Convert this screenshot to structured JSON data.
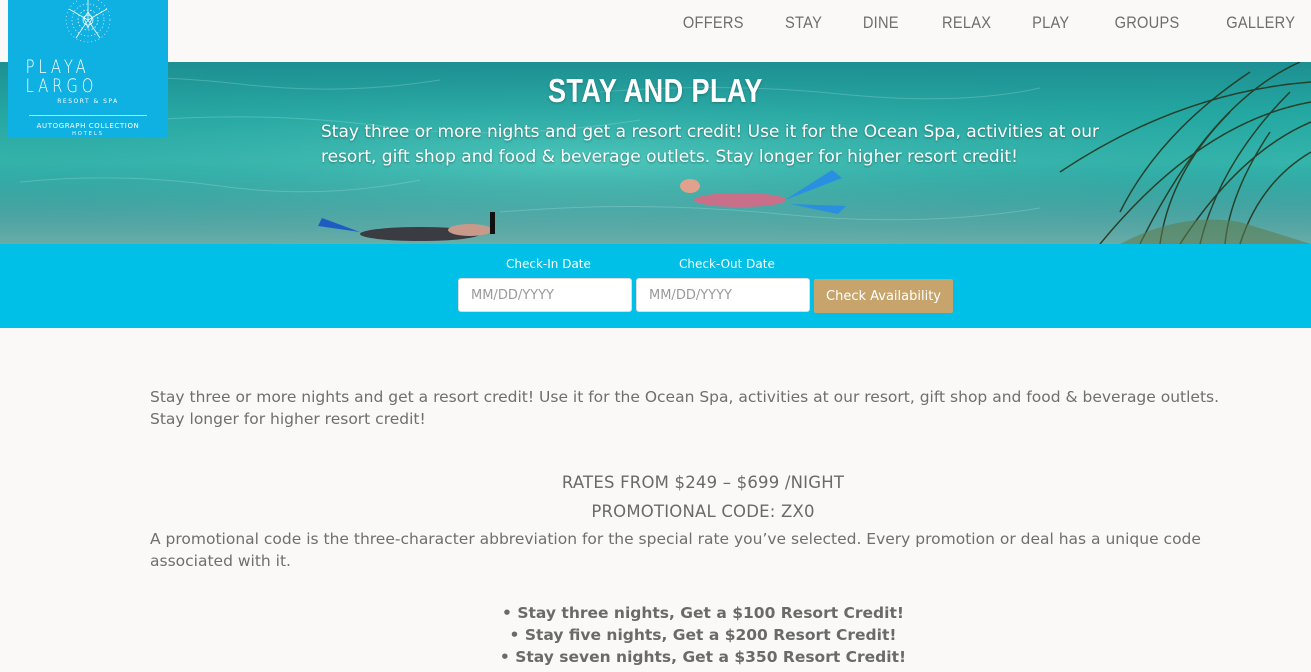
{
  "brand": {
    "name": "PLAYA LARGO",
    "subtitle": "RESORT & SPA",
    "collection": "AUTOGRAPH COLLECTION",
    "collection_sub": "HOTELS",
    "color": "#0fb0e2"
  },
  "nav": {
    "items": [
      "OFFERS",
      "STAY",
      "DINE",
      "RELAX",
      "PLAY",
      "GROUPS",
      "GALLERY"
    ]
  },
  "hero": {
    "title": "STAY AND PLAY",
    "description": "Stay three or more nights and get a resort credit! Use it for the Ocean Spa, activities at our resort, gift shop and food & beverage outlets. Stay longer for higher resort credit!"
  },
  "booking": {
    "checkin_label": "Check-In Date",
    "checkin_placeholder": "MM/DD/YYYY",
    "checkout_label": "Check-Out Date",
    "checkout_placeholder": "MM/DD/YYYY",
    "button_label": "Check Availability",
    "bar_color": "#00c0e8",
    "button_color": "#c6a46c"
  },
  "content": {
    "intro": "Stay three or more nights and get a resort credit! Use it for the Ocean Spa, activities at our resort, gift shop and food & beverage outlets. Stay longer for higher resort credit!",
    "rates": "RATES FROM $249 – $699 /NIGHT",
    "promo_code": "PROMOTIONAL CODE: ZX0",
    "code_note": "A promotional code is the three-character abbreviation for the special rate you’ve selected. Every promotion or deal has a unique code associated with it.",
    "offers": [
      "• Stay three nights, Get a $100 Resort Credit!",
      "• Stay five nights, Get a $200 Resort Credit!",
      "• Stay seven nights, Get a $350 Resort Credit!"
    ]
  }
}
